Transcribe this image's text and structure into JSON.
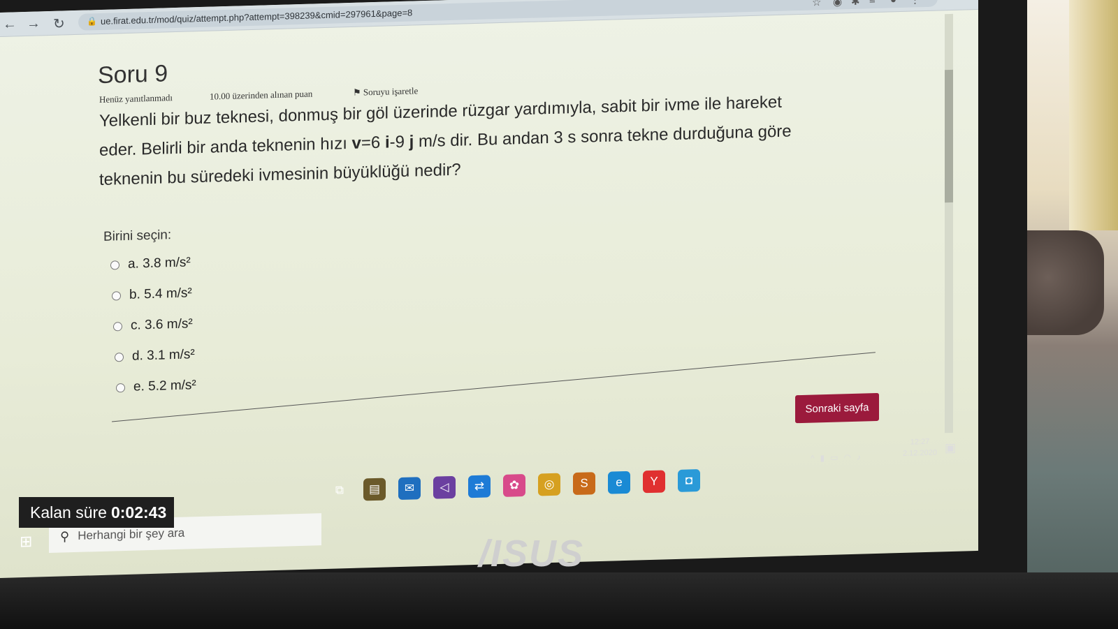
{
  "browser": {
    "url": "ue.firat.edu.tr/mod/quiz/attempt.php?attempt=398239&cmid=297961&page=8",
    "nav_icons": [
      "back-arrow-icon",
      "forward-arrow-icon",
      "reload-icon"
    ]
  },
  "question": {
    "title": "Soru 9",
    "status": "Henüz yanıtlanmadı",
    "points": "10.00 üzerinden alınan puan",
    "flag_label": "Soruyu işaretle",
    "text_line1": "Yelkenli bir buz teknesi, donmuş bir göl üzerinde rüzgar yardımıyla, sabit bir ivme ile hareket",
    "text_line2_a": "eder. Belirli bir anda teknenin hızı ",
    "text_line2_v": "v",
    "text_line2_b": "=6 ",
    "text_line2_i": "i",
    "text_line2_c": "-9 ",
    "text_line2_j": "j",
    "text_line2_d": " m/s dir. Bu andan 3 s sonra tekne durduğuna göre",
    "text_line3": "teknenin bu süredeki ivmesinin büyüklüğü nedir?",
    "choose_label": "Birini seçin:",
    "options": [
      {
        "label": "a. 3.8 m/s²"
      },
      {
        "label": "b. 5.4 m/s²"
      },
      {
        "label": "c. 3.6 m/s²"
      },
      {
        "label": "d. 3.1 m/s²"
      },
      {
        "label": "e. 5.2 m/s²"
      }
    ],
    "next_button": "Sonraki sayfa"
  },
  "timer": {
    "label": "Kalan süre",
    "value": "0:02:43"
  },
  "taskbar": {
    "search_placeholder": "Herhangi bir şey ara",
    "time": "12:27",
    "date": "2.12.2020"
  },
  "brand": "/ISUS"
}
